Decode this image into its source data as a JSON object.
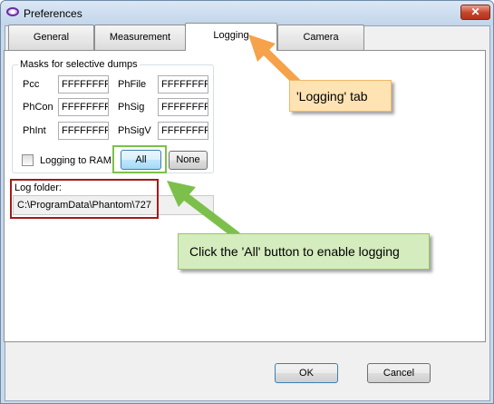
{
  "window": {
    "title": "Preferences",
    "close_glyph": "✕"
  },
  "tabs": [
    {
      "label": "General",
      "active": false
    },
    {
      "label": "Measurement",
      "active": false
    },
    {
      "label": "Logging",
      "active": true
    },
    {
      "label": "Camera",
      "active": false
    }
  ],
  "masks": {
    "group_title": "Masks for selective dumps",
    "rows": [
      {
        "left_label": "Pcc",
        "left_value": "FFFFFFFF",
        "right_label": "PhFile",
        "right_value": "FFFFFFFF"
      },
      {
        "left_label": "PhCon",
        "left_value": "FFFFFFFF",
        "right_label": "PhSig",
        "right_value": "FFFFFFFF"
      },
      {
        "left_label": "PhInt",
        "left_value": "FFFFFFFF",
        "right_label": "PhSigV",
        "right_value": "FFFFFFFF"
      }
    ],
    "logging_to_ram_label": "Logging to RAM",
    "logging_to_ram_checked": false,
    "all_button": "All",
    "none_button": "None"
  },
  "log_folder": {
    "label": "Log folder:",
    "value": "C:\\ProgramData\\Phantom\\727"
  },
  "footer": {
    "ok_button": "OK",
    "cancel_button": "Cancel"
  },
  "annotations": {
    "logging_tab_callout": "'Logging' tab",
    "all_button_callout": "Click the 'All' button to enable logging"
  },
  "colors": {
    "orange_arrow": "#f5a24a",
    "green_arrow": "#7cc04b",
    "red_highlight": "#a21a1a"
  }
}
